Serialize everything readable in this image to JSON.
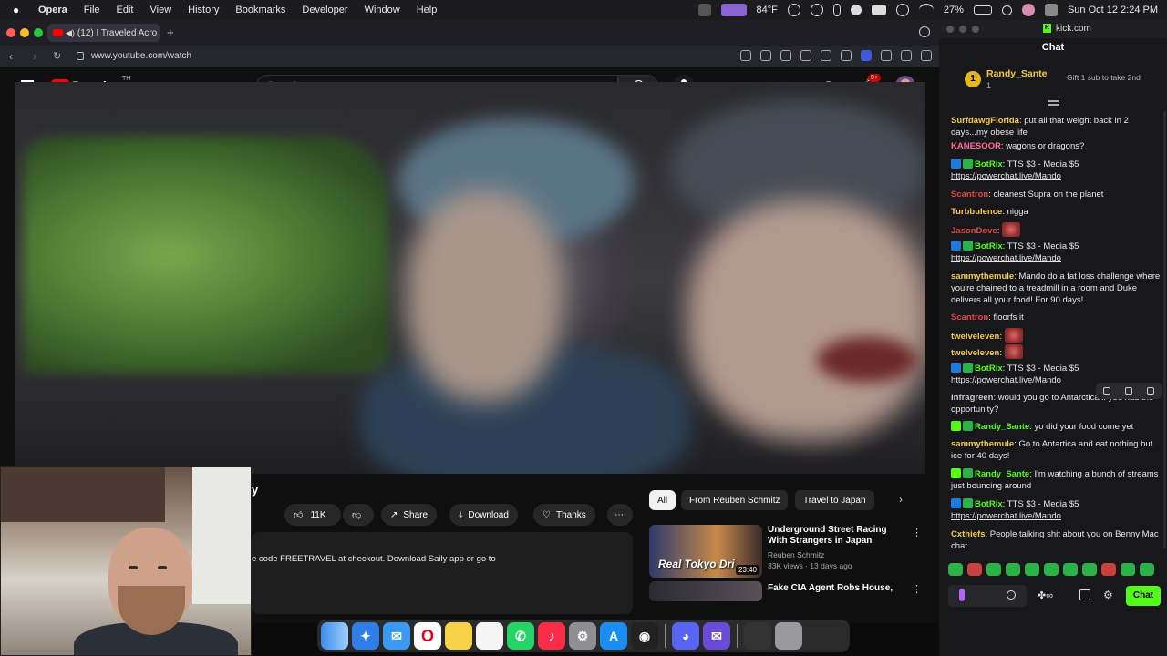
{
  "menubar": {
    "app": "Opera",
    "menus": [
      "File",
      "Edit",
      "View",
      "History",
      "Bookmarks",
      "Developer",
      "Window",
      "Help"
    ],
    "weather": "84°F",
    "battery": "27%",
    "datetime": "Sun Oct 12  2:24 PM"
  },
  "browser": {
    "tab_title": "(12) I Traveled Acro",
    "url": "www.youtube.com/watch"
  },
  "youtube": {
    "brand": "Premium",
    "country_code": "TH",
    "search_placeholder": "Search",
    "notif_count": "9+",
    "title_fragment": "y",
    "actions": {
      "likes": "11K",
      "share": "Share",
      "download": "Download",
      "thanks": "Thanks",
      "more": "⋯"
    },
    "description": "e code FREETRAVEL at checkout. Download Saily app or go to",
    "filter_chips": [
      "All",
      "From Reuben Schmitz",
      "Travel to Japan"
    ],
    "recommendations": [
      {
        "title": "Underground Street Racing With Strangers in Japan",
        "channel": "Reuben Schmitz",
        "meta": "33K views · 13 days ago",
        "duration": "23:40",
        "thumb_text": "Real Tokyo Dri"
      },
      {
        "title": "Fake CIA Agent Robs House,",
        "channel": "",
        "meta": "",
        "duration": "",
        "thumb_text": ""
      }
    ]
  },
  "kick": {
    "site": "kick.com",
    "header": "Chat",
    "top_gifter": {
      "rank": "1",
      "name": "Randy_Sante",
      "count": "1",
      "promo": "Gift 1 sub to take 2nd"
    },
    "messages": [
      {
        "user": "SurfdawgFlorida",
        "color": "#f2c94c",
        "text": "put all that weight back in 2 days...my obese life",
        "badges": []
      },
      {
        "user": "KANESOOR",
        "color": "#ff6b9a",
        "text": "wagons or dragons?",
        "badges": []
      },
      {
        "user": "BotRix",
        "color": "#53fc18",
        "text": "TTS $3 - Media $5",
        "link": "https://powerchat.live/Mando",
        "badges": [
          "bot",
          "verified"
        ]
      },
      {
        "user": "Scantron",
        "color": "#e04848",
        "text": "cleanest Supra on the planet",
        "badges": []
      },
      {
        "user": "Turbbulence",
        "color": "#f2c94c",
        "text": "nigga",
        "badges": []
      },
      {
        "user": "JasonDove",
        "color": "#e04848",
        "text": "",
        "emote": true,
        "badges": []
      },
      {
        "user": "BotRix",
        "color": "#53fc18",
        "text": "TTS $3 - Media $5",
        "link": "https://powerchat.live/Mando",
        "badges": [
          "bot",
          "verified"
        ]
      },
      {
        "user": "sammythemule",
        "color": "#f2c94c",
        "text": "Mando do a fat loss challenge where you're chained to a treadmill in a room and Duke delivers all your food! For 90 days!",
        "badges": []
      },
      {
        "user": "Scantron",
        "color": "#e04848",
        "text": "floorfs it",
        "badges": []
      },
      {
        "user": "twelveleven",
        "color": "#f2c94c",
        "text": "",
        "emote": true,
        "badges": []
      },
      {
        "user": "twelveleven",
        "color": "#f2c94c",
        "text": "",
        "emote": true,
        "badges": []
      },
      {
        "user": "BotRix",
        "color": "#53fc18",
        "text": "TTS $3 - Media $5",
        "link": "https://powerchat.live/Mando",
        "badges": [
          "bot",
          "verified"
        ]
      },
      {
        "user": "Infragreen",
        "color": "#c9c9d6",
        "text": "would you go to Antarctica if you had the opportunity?",
        "badges": []
      },
      {
        "user": "Randy_Sante",
        "color": "#53fc18",
        "text": "yo did your food come yet",
        "badges": [
          "gift",
          "sub"
        ]
      },
      {
        "user": "sammythemule",
        "color": "#f2c94c",
        "text": "Go to Antartica and eat nothing but ice for 40 days!",
        "badges": []
      },
      {
        "user": "Randy_Sante",
        "color": "#53fc18",
        "text": "I'm watching a bunch of streams just bouncing around",
        "badges": [
          "gift",
          "sub"
        ]
      },
      {
        "user": "BotRix",
        "color": "#53fc18",
        "text": "TTS $3 - Media $5",
        "link": "https://powerchat.live/Mando",
        "badges": [
          "bot",
          "verified"
        ]
      },
      {
        "user": "Cxthiefs",
        "color": "#f2c94c",
        "text": "People talking shit about you on Benny Mac chat",
        "badges": []
      }
    ],
    "send_label": "Chat"
  }
}
